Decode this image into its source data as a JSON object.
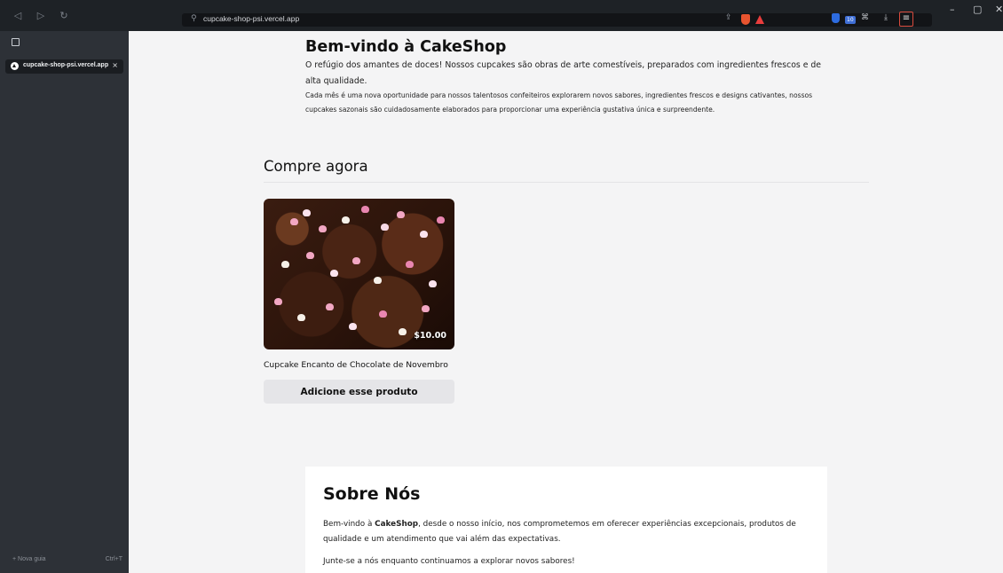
{
  "browser": {
    "url": "cupcake-shop-psi.vercel.app",
    "extension_badge": "10",
    "icons": [
      "back-icon",
      "forward-icon",
      "reload-icon",
      "site-info-icon",
      "share-icon",
      "brave-shields-icon",
      "brave-rewards-icon",
      "bitwarden-icon",
      "extension-icon",
      "puzzle-icon",
      "download-icon",
      "menu-icon"
    ],
    "window": {
      "minimize": "–",
      "maximize": "▢",
      "close": "✕"
    }
  },
  "sidebar": {
    "tab_title": "cupcake-shop-psi.vercel.app",
    "tab_close": "×",
    "new_tab_label": "+ Nova guia",
    "new_tab_shortcut": "Ctrl+T"
  },
  "welcome": {
    "title": "Bem-vindo à CakeShop",
    "intro": "O refúgio dos amantes de doces! Nossos cupcakes são obras de arte comestíveis, preparados com ingredientes frescos e de alta qualidade.",
    "body": "Cada mês é uma nova oportunidade para nossos talentosos confeiteiros explorarem novos sabores, ingredientes frescos e designs cativantes, nossos cupcakes sazonais são cuidadosamente elaborados para proporcionar uma experiência gustativa única e surpreendente."
  },
  "shop": {
    "title": "Compre agora",
    "products": [
      {
        "name": "Cupcake Encanto de Chocolate de Novembro",
        "price": "$10.00",
        "button_label": "Adicione esse produto"
      }
    ]
  },
  "about": {
    "title": "Sobre Nós",
    "p1_before": "Bem-vindo à ",
    "p1_brand": "CakeShop",
    "p1_after": ", desde o nosso início, nos comprometemos em oferecer experiências excepcionais, produtos de qualidade e um atendimento que vai além das expectativas.",
    "p2": "Junte-se a nós enquanto continuamos a explorar novos sabores!"
  }
}
